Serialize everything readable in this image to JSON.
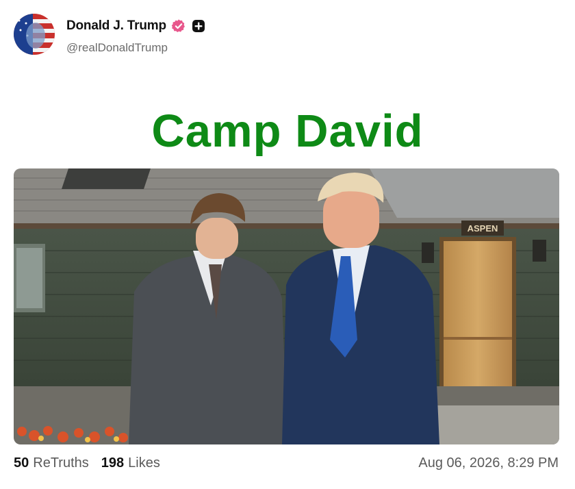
{
  "author": {
    "display_name": "Donald J. Trump",
    "handle": "@realDonaldTrump",
    "verified_icon": "verified-badge-icon",
    "badge_icon": "plus-badge-icon",
    "badge_color": "#e8578c"
  },
  "post": {
    "image_caption_text": "Camp David",
    "sign_text": "ASPEN",
    "caption_color": "#0e8a16"
  },
  "stats": {
    "retruths_count": "50",
    "retruths_label": "ReTruths",
    "likes_count": "198",
    "likes_label": "Likes"
  },
  "timestamp": "Aug 06, 2026, 8:29 PM"
}
